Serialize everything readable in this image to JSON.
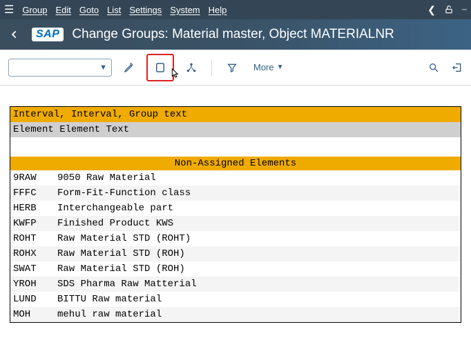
{
  "menubar": {
    "items": [
      "Group",
      "Edit",
      "Goto",
      "List",
      "Settings",
      "System",
      "Help"
    ]
  },
  "header": {
    "logo_text": "SAP",
    "title": "Change Groups: Material master, Object MATERIALNR"
  },
  "toolbar": {
    "more_label": "More"
  },
  "legend": {
    "interval_row": "Interval, Interval, Group text",
    "element_row": "Element Element Text"
  },
  "section": {
    "title": "Non-Assigned Elements"
  },
  "elements": [
    {
      "code": "9RAW",
      "text": "9050 Raw Material"
    },
    {
      "code": "FFFC",
      "text": "Form-Fit-Function class"
    },
    {
      "code": "HERB",
      "text": "Interchangeable part"
    },
    {
      "code": "KWFP",
      "text": "Finished Product KWS"
    },
    {
      "code": "ROHT",
      "text": "Raw Material STD (ROHT)"
    },
    {
      "code": "ROHX",
      "text": "Raw Material STD (ROH)"
    },
    {
      "code": "SWAT",
      "text": "Raw Material STD (ROH)"
    },
    {
      "code": "YROH",
      "text": "SDS Pharma Raw Matterial"
    },
    {
      "code": "LUND",
      "text": "BITTU Raw material"
    },
    {
      "code": "MOH",
      "text": "mehul raw material"
    }
  ]
}
